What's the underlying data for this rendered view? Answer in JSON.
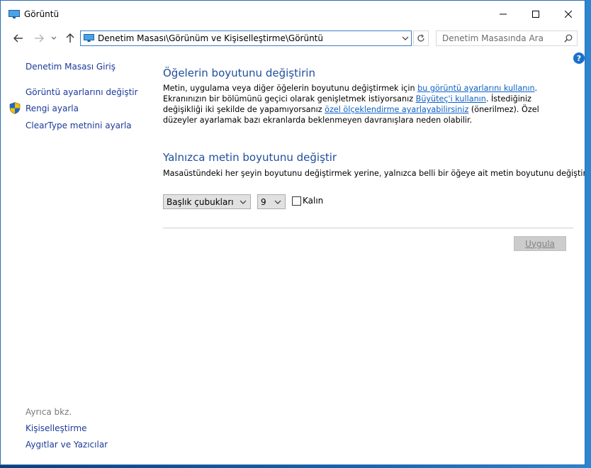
{
  "window": {
    "title": "Görüntü"
  },
  "nav": {
    "address": "Denetim Masası\\Görünüm ve Kişiselleştirme\\Görüntü",
    "search_placeholder": "Denetim Masasında Ara",
    "help_label": "?"
  },
  "sidebar": {
    "items": [
      {
        "label": "Denetim Masası Giriş"
      },
      {
        "label": "Görüntü ayarlarını değiştir"
      },
      {
        "label": "Rengi ayarla"
      },
      {
        "label": "ClearType metnini ayarla"
      }
    ],
    "see_also_label": "Ayrıca bkz.",
    "see_also": [
      {
        "label": "Kişiselleştirme"
      },
      {
        "label": "Aygıtlar ve Yazıcılar"
      }
    ]
  },
  "main": {
    "section1": {
      "heading": "Öğelerin boyutunu değiştirin",
      "p_1": "Metin, uygulama veya diğer öğelerin boyutunu değiştirmek için ",
      "link_1": "bu görüntü ayarlarını kullanın",
      "p_2": ". Ekranınızın bir bölümünü geçici olarak genişletmek istiyorsanız ",
      "link_2": "Büyüteç'i kullanın",
      "p_3": ". İstediğiniz değişikliği iki şekilde de yapamıyorsanız ",
      "link_3": "özel ölçeklendirme ayarlayabilirsiniz",
      "p_4": " (önerilmez). Özel düzeyler ayarlamak bazı ekranlarda beklenmeyen davranışlara neden olabilir."
    },
    "section2": {
      "heading": "Yalnızca metin boyutunu değiştir",
      "description": "Masaüstündeki her şeyin boyutunu değiştirmek yerine, yalnızca belli bir öğeye ait metin boyutunu değiştirin.",
      "item_select": "Başlık çubukları",
      "size_select": "9",
      "bold_label": "Kalın",
      "bold_checked": false
    },
    "apply_label": "Uygula"
  },
  "colors": {
    "link": "#1a3a9a",
    "heading": "#1e4e9c",
    "address_border": "#3c7fc4"
  }
}
